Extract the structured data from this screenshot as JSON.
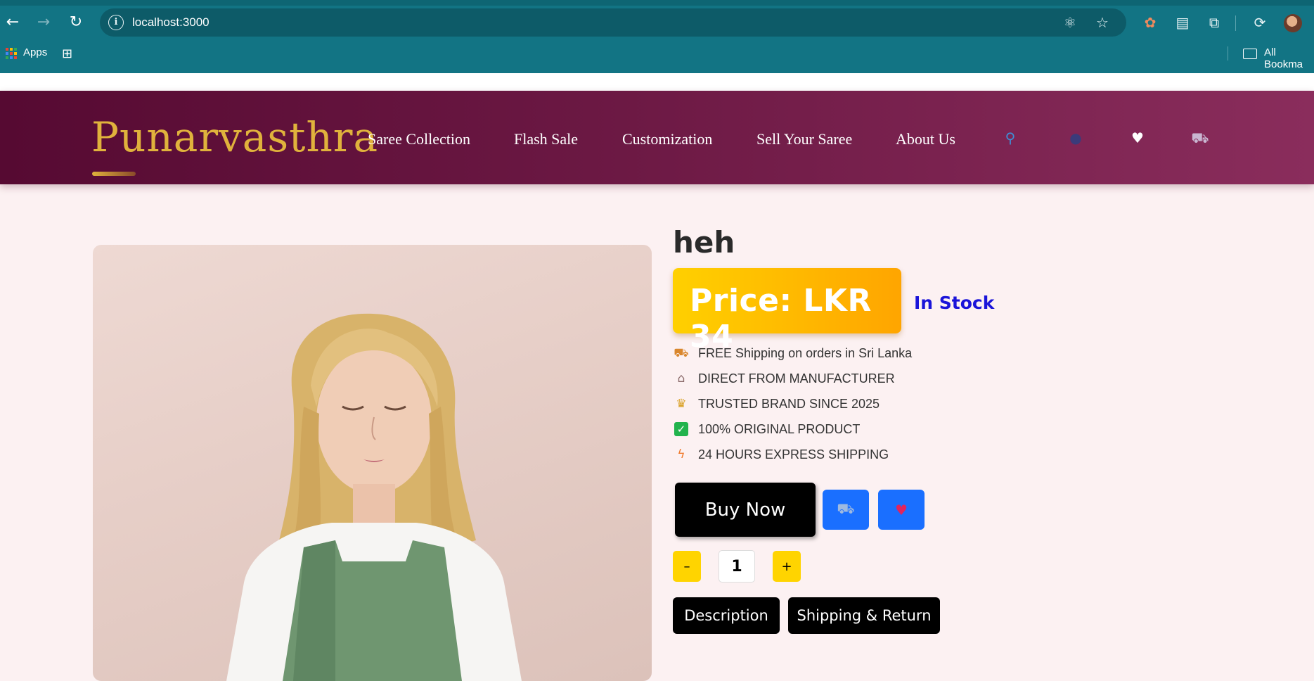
{
  "browser": {
    "url": "localhost:3000",
    "bookmarks": {
      "apps_label": "Apps",
      "all_bookmarks_label": "All Bookma"
    },
    "icons": [
      "back-icon",
      "forward-icon",
      "reload-icon",
      "site-info-icon",
      "react-devtools-icon",
      "bookmark-star-icon",
      "extension-icon",
      "profile-avatar"
    ]
  },
  "site": {
    "logo": "Punarvasthra",
    "nav": [
      "Saree Collection",
      "Flash Sale",
      "Customization",
      "Sell Your Saree",
      "About Us"
    ],
    "header_icons": [
      "search-icon",
      "user-icon",
      "heart-icon",
      "cart-icon"
    ],
    "colors": {
      "header_start": "#560a32",
      "header_end": "#8a2d5c",
      "logo": "#e0b23c",
      "price_start": "#ffd000",
      "price_end": "#ffa500",
      "stock": "#1a14d9",
      "action_blue": "#1a6fff",
      "qty_yellow": "#ffd400"
    }
  },
  "product": {
    "title": "heh",
    "price": "Price: LKR 34",
    "stock_status": "In Stock",
    "features": [
      {
        "icon": "truck-icon",
        "text": "FREE Shipping on orders in Sri Lanka"
      },
      {
        "icon": "factory-icon",
        "text": "DIRECT FROM MANUFACTURER"
      },
      {
        "icon": "trophy-icon",
        "text": "TRUSTED BRAND SINCE 2025"
      },
      {
        "icon": "check-icon",
        "text": "100% ORIGINAL PRODUCT"
      },
      {
        "icon": "lightning-icon",
        "text": "24 HOURS EXPRESS SHIPPING"
      }
    ],
    "buy_now_label": "Buy Now",
    "quantity": "1",
    "qty_minus": "–",
    "qty_plus": "+",
    "tabs": [
      "Description",
      "Shipping & Return"
    ]
  }
}
